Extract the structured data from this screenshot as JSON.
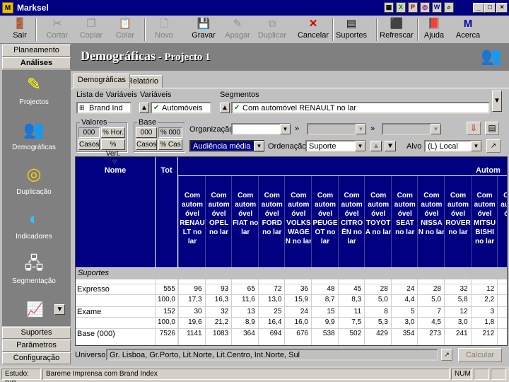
{
  "window": {
    "title": "Marksel"
  },
  "toolbar": {
    "items": [
      {
        "label": "Sair",
        "icon": "exit-icon",
        "enabled": true
      },
      {
        "label": "Cortar",
        "icon": "scissors-icon",
        "enabled": false
      },
      {
        "label": "Copiar",
        "icon": "copy-icon",
        "enabled": false
      },
      {
        "label": "Colar",
        "icon": "paste-icon",
        "enabled": false
      },
      {
        "label": "Novo",
        "icon": "new-file-icon",
        "enabled": false
      },
      {
        "label": "Gravar",
        "icon": "save-icon",
        "enabled": true
      },
      {
        "label": "Apagar",
        "icon": "eraser-icon",
        "enabled": false
      },
      {
        "label": "Duplicar",
        "icon": "duplicate-icon",
        "enabled": false
      },
      {
        "label": "Cancelar",
        "icon": "cancel-icon",
        "enabled": true
      },
      {
        "label": "Suportes",
        "icon": "media-icon",
        "enabled": true
      },
      {
        "label": "Refrescar",
        "icon": "refresh-icon",
        "enabled": true
      },
      {
        "label": "Ajuda",
        "icon": "help-book-icon",
        "enabled": true
      },
      {
        "label": "Acerca",
        "icon": "about-icon",
        "enabled": true
      }
    ]
  },
  "leftnav": {
    "top_buttons": [
      "Planeamento",
      "Análises"
    ],
    "icons": [
      {
        "label": "Projectos",
        "icon": "projects-icon"
      },
      {
        "label": "Demográficas",
        "icon": "demographics-icon"
      },
      {
        "label": "Duplicação",
        "icon": "duplication-icon"
      },
      {
        "label": "Indicadores",
        "icon": "indicators-icon"
      },
      {
        "label": "Segmentação",
        "icon": "segmentation-icon"
      }
    ],
    "bottom_buttons": [
      "Suportes",
      "Parâmetros",
      "Configuração"
    ]
  },
  "header": {
    "title": "Demográficas",
    "subtitle": " - Projecto 1"
  },
  "tabs": [
    "Demográficas",
    "Relatório"
  ],
  "filters": {
    "lista_label": "Lista de Variáveis",
    "lista_value": "Brand Ind",
    "variaveis_label": "Variáveis",
    "variaveis_value": "Automóveis",
    "segmentos_label": "Segmentos",
    "segmentos_value": "Com automóvel RENAULT no lar",
    "valores_label": "Valores",
    "valores_num": "000",
    "valores_hor": "% Hor.",
    "valores_casos": "Casos",
    "valores_vert": "% Vert.",
    "base_label": "Base",
    "base_num": "000",
    "base_pct": "% 000",
    "base_casos": "Casos",
    "base_cas": "% Cas",
    "org_label": "Organização",
    "org_value": "",
    "arrows": "»",
    "audiencia_value": "Audiência média",
    "ordenacao_label": "Ordenação",
    "ordenacao_value": "Suporte",
    "alvo_label": "Alvo",
    "alvo_value": "(L) Local"
  },
  "grid": {
    "col_nome": "Nome",
    "col_tot": "Tot",
    "group_header": "Autom",
    "columns": [
      "Com autom óvel RENAU LT no lar",
      "Com autom óvel OPEL no lar",
      "Com autom óvel FIAT no lar",
      "Com autom óvel FORD no lar",
      "Com autom óvel VOLKS WAGE N no lar",
      "Com autom óvel PEUGE OT no lar",
      "Com autom óvel CITRO ËN no lar",
      "Com autom óvel TOYOT A no lar",
      "Com autom óvel SEAT no lar",
      "Com autom óvel NISSA N no lar",
      "Com autom óvel ROVER no lar",
      "Com autom óvel MITSU BISHI no lar",
      "Com autom óvel"
    ],
    "section_label": "Suportes",
    "rows": [
      {
        "label": "Expresso",
        "tot": "555",
        "values": [
          "96",
          "93",
          "65",
          "72",
          "36",
          "48",
          "45",
          "28",
          "24",
          "28",
          "32",
          "12",
          ""
        ]
      },
      {
        "label": "",
        "tot": "100,0",
        "values": [
          "17,3",
          "16,3",
          "11,6",
          "13,0",
          "15,9",
          "8,7",
          "8,3",
          "5,0",
          "4,4",
          "5,0",
          "5,8",
          "2,2",
          ""
        ]
      },
      {
        "label": "Exame",
        "tot": "152",
        "values": [
          "30",
          "32",
          "13",
          "25",
          "24",
          "15",
          "11",
          "8",
          "5",
          "7",
          "12",
          "3",
          ""
        ]
      },
      {
        "label": "",
        "tot": "100,0",
        "values": [
          "19,6",
          "21,2",
          "8,9",
          "16,4",
          "16,0",
          "9,9",
          "7,5",
          "5,3",
          "3,0",
          "4,5",
          "3,0",
          "1,8",
          ""
        ]
      },
      {
        "label": "Base (000)",
        "tot": "7526",
        "values": [
          "1141",
          "1083",
          "364",
          "694",
          "676",
          "538",
          "502",
          "429",
          "354",
          "273",
          "241",
          "212",
          ""
        ]
      }
    ]
  },
  "universo": {
    "label": "Universo",
    "value": "Gr. Lisboa, Gr.Porto, Lit.Norte, Lit.Centro, Int.Norte, Sul",
    "calc_label": "Calcular"
  },
  "status": {
    "estudo": "Estudo: BIB",
    "desc": "Bareme Imprensa com Brand Index",
    "num": "NUM"
  },
  "colors": {
    "titlebar": "#000080",
    "grid_header": "#000080",
    "selection": "#000080"
  }
}
